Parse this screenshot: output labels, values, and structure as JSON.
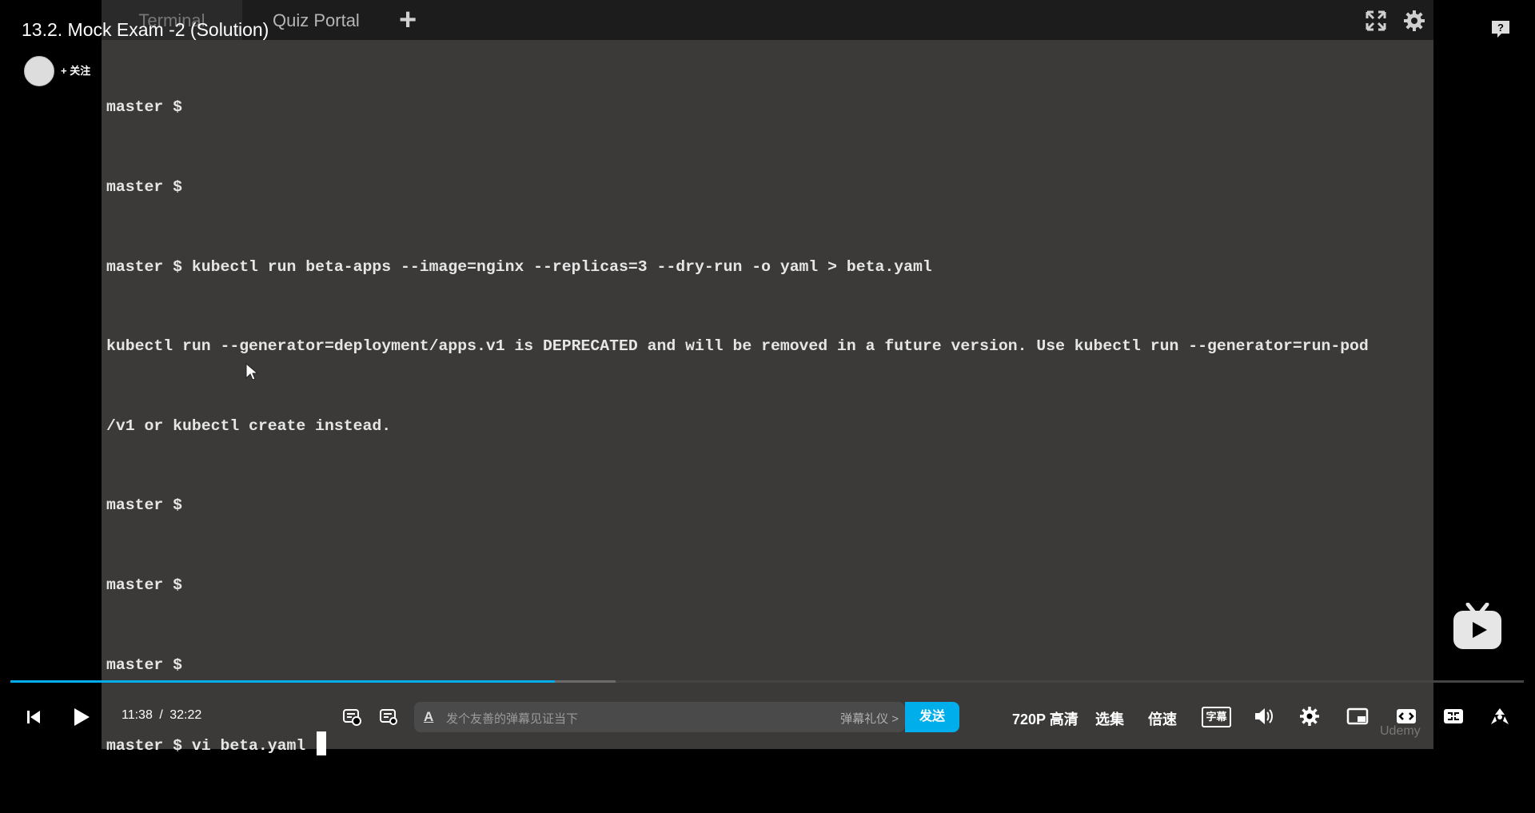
{
  "video": {
    "title": "13.2. Mock Exam -2 (Solution)",
    "follow_label": "+ 关注"
  },
  "terminal": {
    "tabs": [
      {
        "label": "Terminal"
      },
      {
        "label": "Quiz Portal"
      }
    ],
    "add_tab_label": "+",
    "lines": [
      "master $",
      "master $",
      "master $ kubectl run beta-apps --image=nginx --replicas=3 --dry-run -o yaml > beta.yaml",
      "kubectl run --generator=deployment/apps.v1 is DEPRECATED and will be removed in a future version. Use kubectl run --generator=run-pod",
      "/v1 or kubectl create instead.",
      "master $",
      "master $",
      "master $",
      "master $ vi beta.yaml"
    ]
  },
  "player": {
    "current_time": "11:38",
    "separator": "/",
    "duration": "32:22",
    "progress_played": 0.36,
    "progress_buffered": 0.4,
    "danmaku": {
      "placeholder": "发个友善的弹幕见证当下",
      "etiquette_label": "弹幕礼仪 >",
      "send_label": "发送"
    },
    "quality_label": "720P 高清",
    "episodes_label": "选集",
    "speed_label": "倍速",
    "subtitle_label": "字幕",
    "watermark": "Udemy"
  },
  "colors": {
    "accent": "#00aeec",
    "terminal_bg": "#3b3a38",
    "tab_bar_bg": "#1c1c1c"
  }
}
